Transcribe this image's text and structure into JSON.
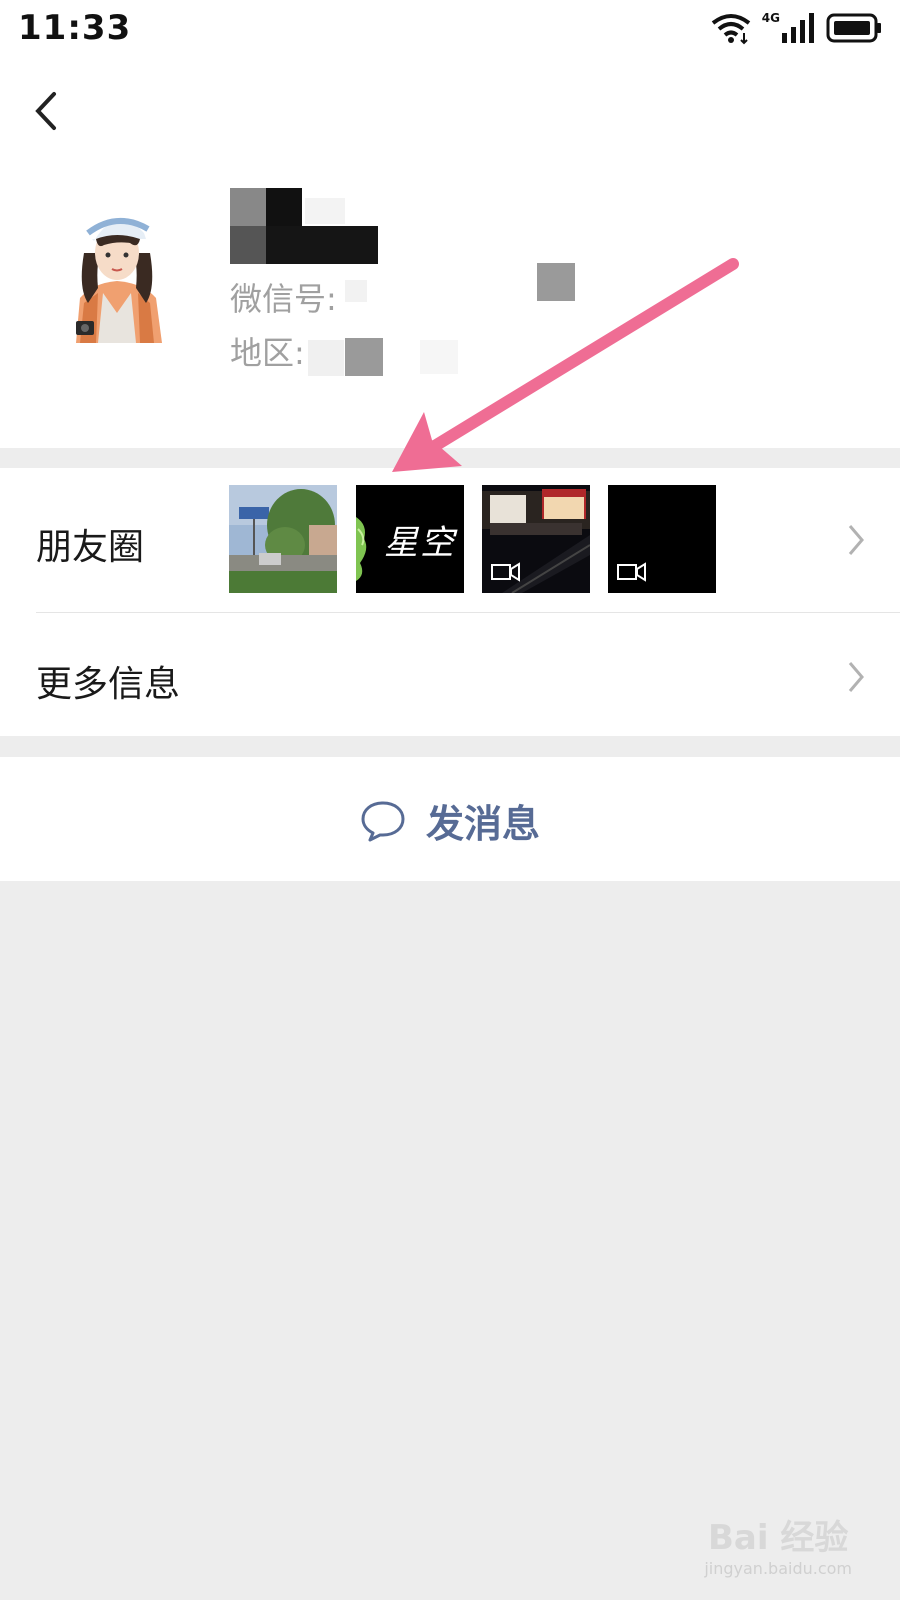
{
  "status_bar": {
    "time": "11:33",
    "network": "4G",
    "icons": [
      "wifi-icon",
      "signal-icon",
      "battery-icon"
    ]
  },
  "header": {
    "back_icon": "chevron-left-icon",
    "wechat_id_label": "微信号:",
    "region_label": "地区:"
  },
  "moments": {
    "label": "朋友圈",
    "thumbnails": [
      {
        "type": "photo",
        "caption": ""
      },
      {
        "type": "photo",
        "caption": "星空"
      },
      {
        "type": "video",
        "caption": ""
      },
      {
        "type": "video",
        "caption": ""
      }
    ]
  },
  "more_info": {
    "label": "更多信息"
  },
  "actions": {
    "send_message_label": "发消息",
    "send_icon": "chat-bubble-icon"
  },
  "watermark": {
    "main": "Bai 经验",
    "sub": "jingyan.baidu.com"
  },
  "colors": {
    "link_blue": "#576b95",
    "annotation_arrow": "#ef6d94",
    "background": "#ededed"
  }
}
